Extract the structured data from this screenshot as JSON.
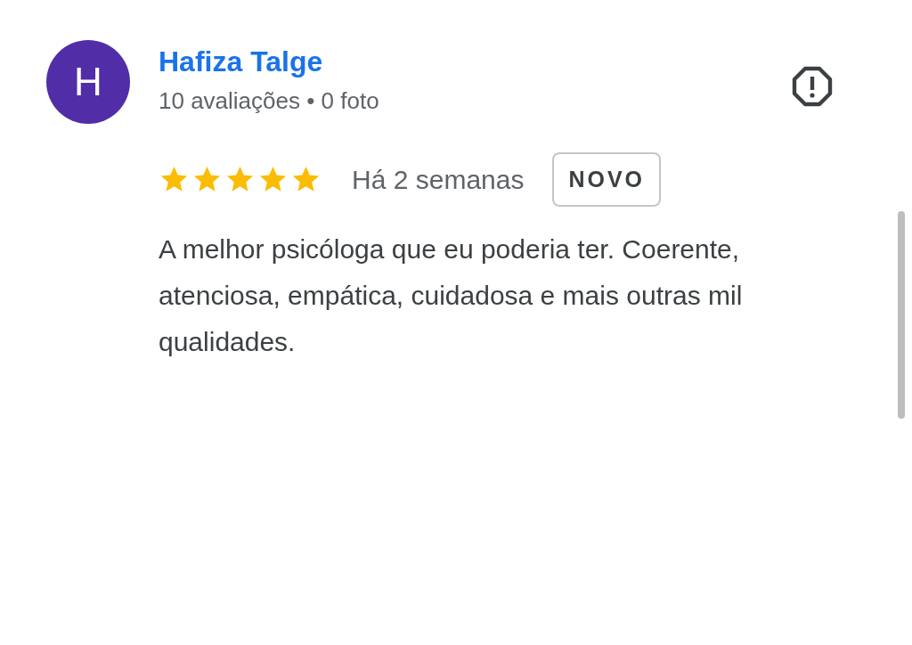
{
  "review": {
    "avatar_letter": "H",
    "author": "Hafiza Talge",
    "author_stats": "10 avaliações • 0 foto",
    "stars": 5,
    "time": "Há 2 semanas",
    "badge": "NOVO",
    "text": "A melhor psicóloga que eu poderia ter. Coerente, atenciosa, empática, cuidadosa e mais outras mil qualidades."
  }
}
